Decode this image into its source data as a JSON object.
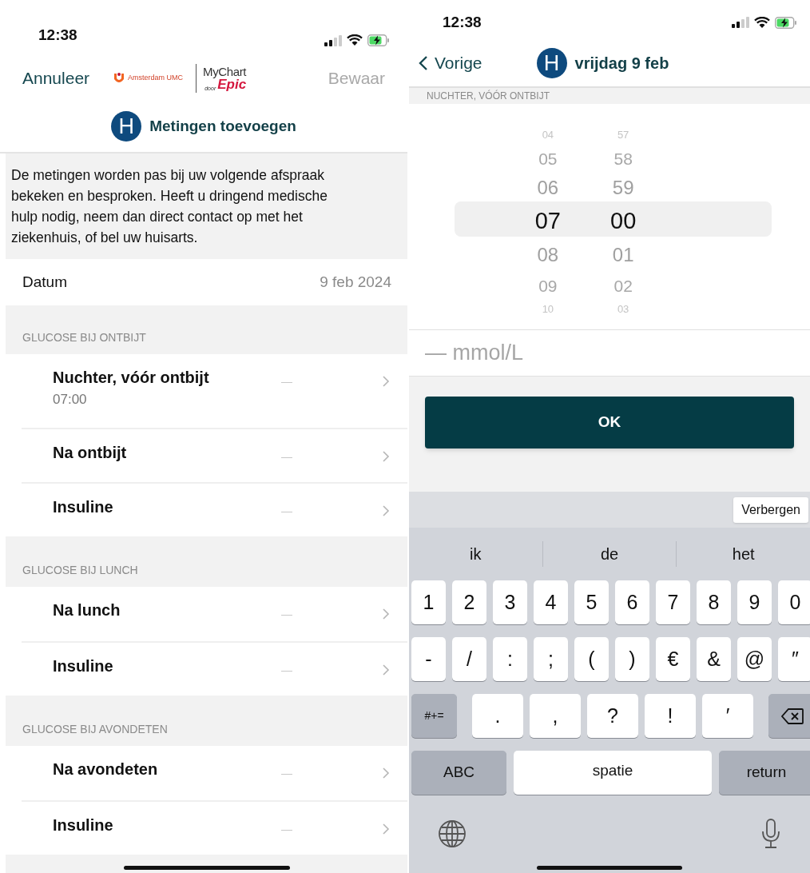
{
  "left_screen": {
    "status_bar": {
      "time": "12:38"
    },
    "nav": {
      "cancel": "Annuleer",
      "save": {
        "label": "Bewaar",
        "disabled": true
      },
      "logo_amsterdam": "Amsterdam UMC",
      "logo_mychart": {
        "name": "MyChart",
        "by": "door",
        "brand": "Epic"
      }
    },
    "title": {
      "avatar": "H",
      "text": "Metingen toevoegen"
    },
    "notice": "De metingen worden pas bij uw volgende afspraak bekeken en besproken. Heeft u dringend medische hulp nodig, neem dan direct contact op met het ziekenhuis, of bel uw huisarts.",
    "date_row": {
      "label": "Datum",
      "value": "9 feb 2024"
    },
    "sections": [
      {
        "header": "GLUCOSE BIJ ONTBIJT",
        "rows": [
          {
            "label": "Nuchter, vóór ontbijt",
            "time": "07:00",
            "value": "—"
          },
          {
            "label": "Na ontbijt",
            "value": "—"
          },
          {
            "label": "Insuline",
            "value": "—"
          }
        ]
      },
      {
        "header": "GLUCOSE BIJ LUNCH",
        "rows": [
          {
            "label": "Na lunch",
            "value": "—"
          },
          {
            "label": "Insuline",
            "value": "—"
          }
        ]
      },
      {
        "header": "GLUCOSE BIJ AVONDETEN",
        "rows": [
          {
            "label": "Na avondeten",
            "value": "—"
          },
          {
            "label": "Insuline",
            "value": "—"
          }
        ]
      }
    ]
  },
  "right_screen": {
    "status_bar": {
      "time": "12:38"
    },
    "nav": {
      "back": "Vorige",
      "avatar": "H",
      "title": "vrijdag 9 feb"
    },
    "section_header": "NUCHTER, VÓÓR ONTBIJT",
    "time_picker": {
      "hours": [
        {
          "text": "04",
          "selected": false
        },
        {
          "text": "05",
          "selected": false
        },
        {
          "text": "06",
          "selected": false
        },
        {
          "text": "07",
          "selected": true
        },
        {
          "text": "08",
          "selected": false
        },
        {
          "text": "09",
          "selected": false
        },
        {
          "text": "10",
          "selected": false
        }
      ],
      "minutes": [
        {
          "text": "57",
          "selected": false
        },
        {
          "text": "58",
          "selected": false
        },
        {
          "text": "59",
          "selected": false
        },
        {
          "text": "00",
          "selected": true
        },
        {
          "text": "01",
          "selected": false
        },
        {
          "text": "02",
          "selected": false
        },
        {
          "text": "03",
          "selected": false
        }
      ]
    },
    "value_field": {
      "placeholder": "— mmol/L"
    },
    "ok_button": "OK",
    "keyboard": {
      "hide_button": "Verbergen",
      "suggestions": [
        "ik",
        "de",
        "het"
      ],
      "number_row": [
        {
          "kind": "char",
          "label": "1"
        },
        {
          "kind": "char",
          "label": "2"
        },
        {
          "kind": "char",
          "label": "3"
        },
        {
          "kind": "char",
          "label": "4"
        },
        {
          "kind": "char",
          "label": "5"
        },
        {
          "kind": "char",
          "label": "6"
        },
        {
          "kind": "char",
          "label": "7"
        },
        {
          "kind": "char",
          "label": "8"
        },
        {
          "kind": "char",
          "label": "9"
        },
        {
          "kind": "char",
          "label": "0"
        }
      ],
      "symbol_row": [
        {
          "kind": "char",
          "label": "-"
        },
        {
          "kind": "char",
          "label": "/"
        },
        {
          "kind": "char",
          "label": ":"
        },
        {
          "kind": "char",
          "label": ";"
        },
        {
          "kind": "char",
          "label": "("
        },
        {
          "kind": "char",
          "label": ")"
        },
        {
          "kind": "char",
          "label": "€"
        },
        {
          "kind": "char",
          "label": "&"
        },
        {
          "kind": "char",
          "label": "@"
        },
        {
          "kind": "char",
          "label": "″"
        }
      ],
      "punctuation_row": [
        {
          "kind": "function",
          "label": "#+="
        },
        {
          "kind": "wide",
          "label": "."
        },
        {
          "kind": "wide",
          "label": ","
        },
        {
          "kind": "wide",
          "label": "?"
        },
        {
          "kind": "wide",
          "label": "!"
        },
        {
          "kind": "wide",
          "label": "′"
        },
        {
          "kind": "delete"
        }
      ],
      "bottom_row": [
        {
          "kind": "function_wide",
          "label": "ABC"
        },
        {
          "kind": "space",
          "label": "spatie"
        },
        {
          "kind": "function_wide",
          "label": "return"
        }
      ]
    }
  }
}
